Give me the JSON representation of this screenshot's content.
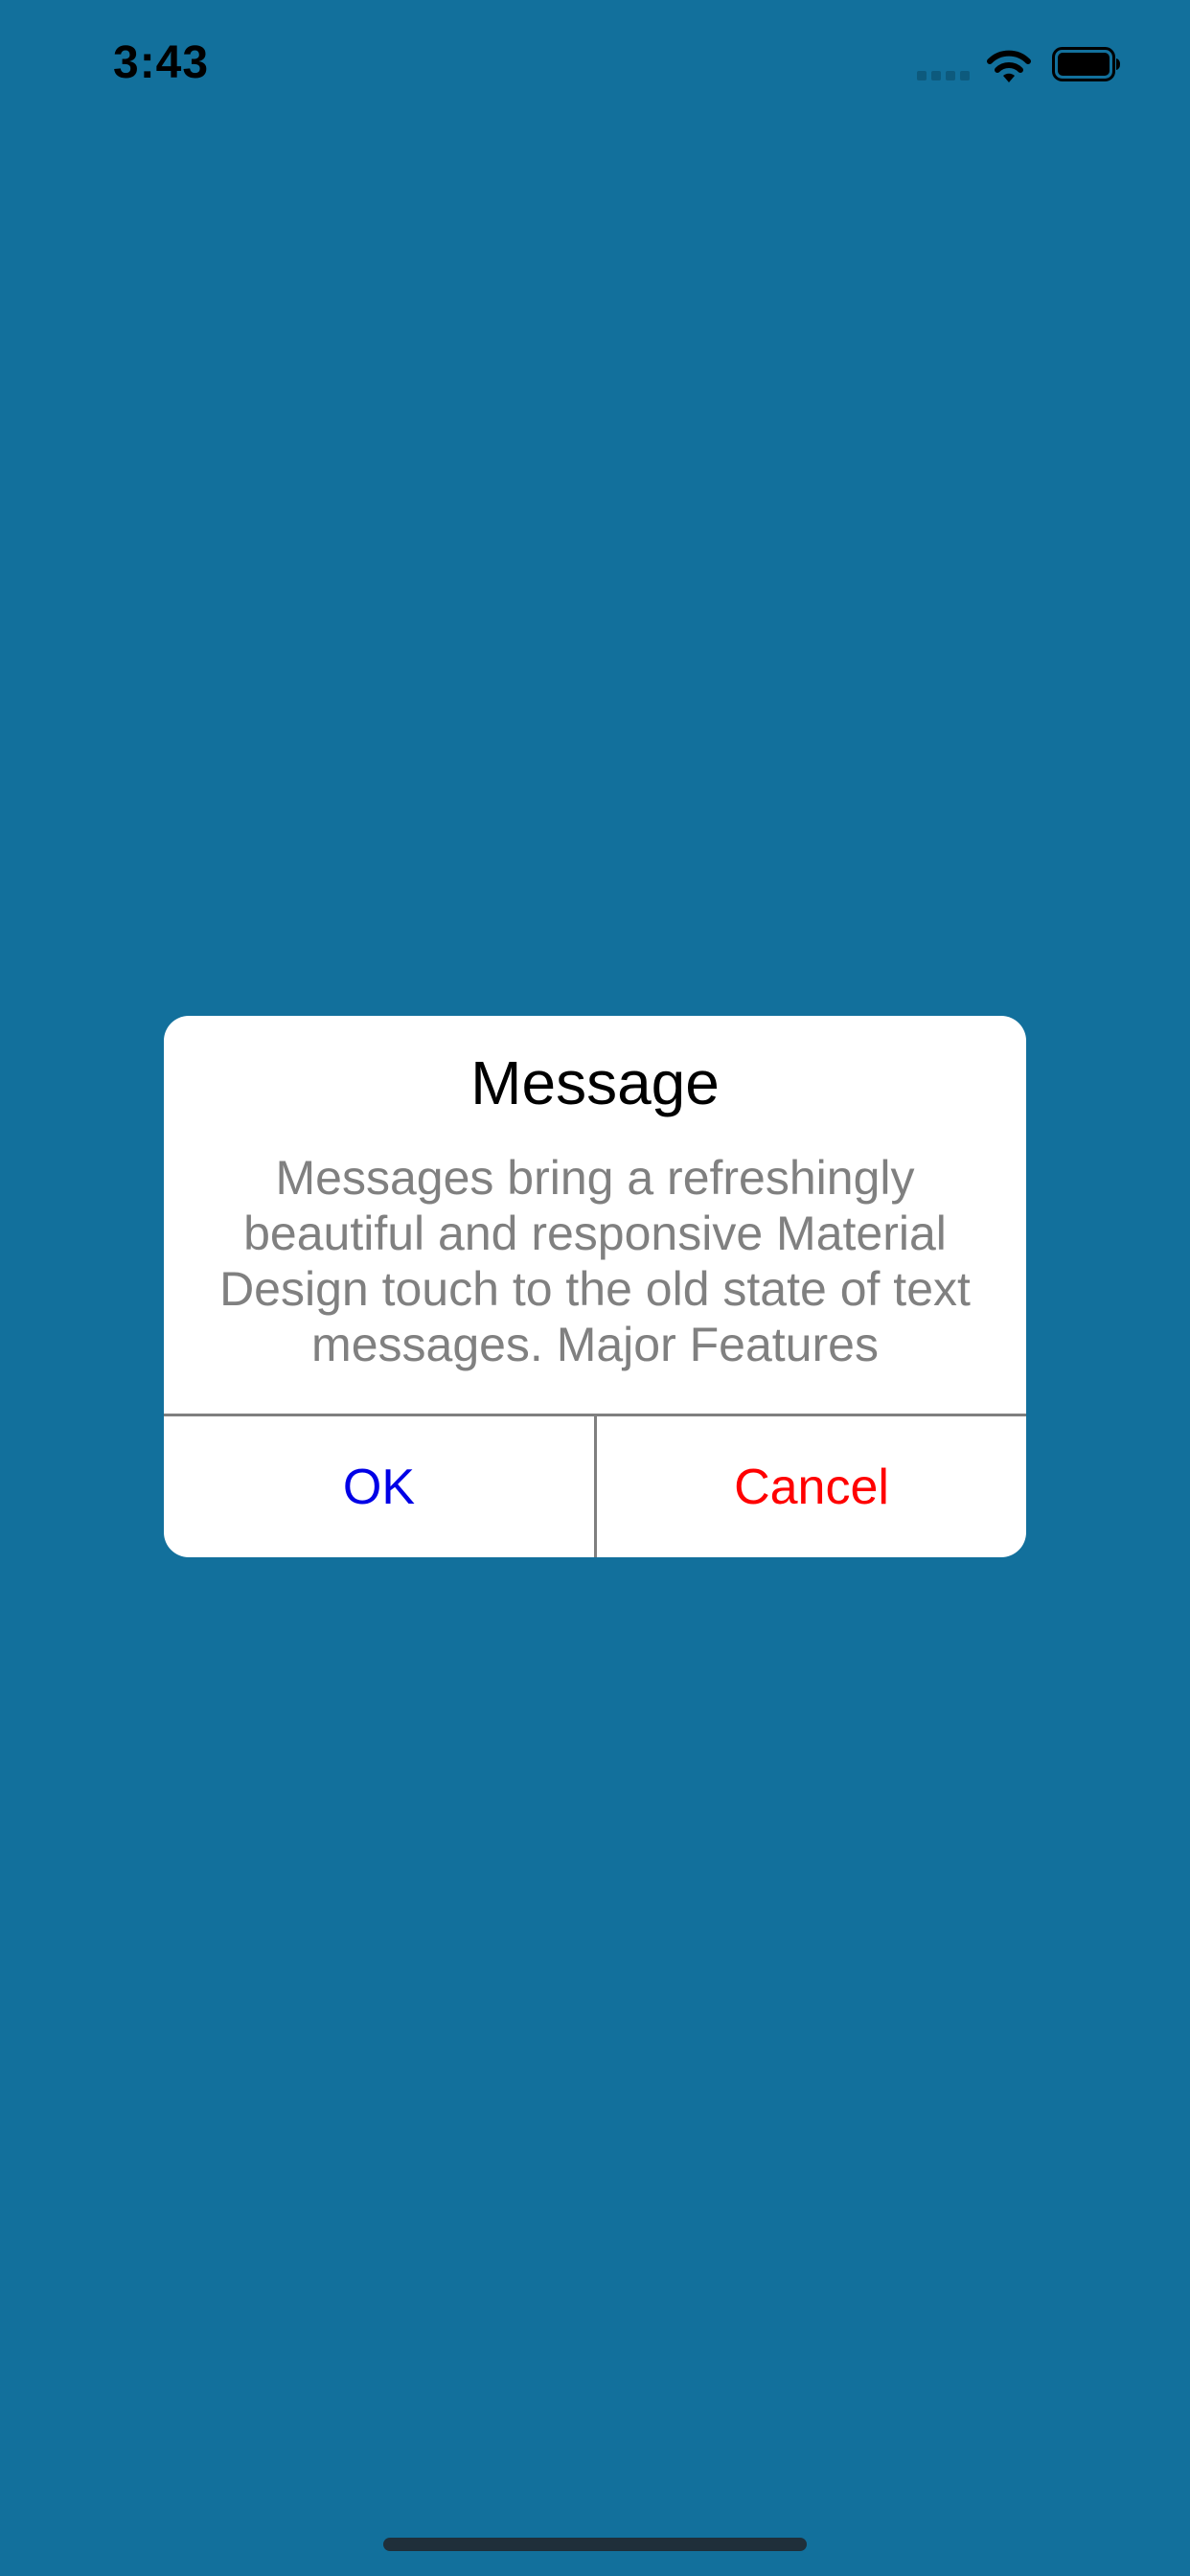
{
  "status_bar": {
    "time": "3:43",
    "icons": [
      "cellular-signal-icon",
      "wifi-icon",
      "battery-icon"
    ]
  },
  "colors": {
    "background": "#12709c",
    "ok_button": "#0000e6",
    "cancel_button": "#ff0000",
    "message_text": "#808080"
  },
  "dialog": {
    "title": "Message",
    "message": "Messages bring a refreshingly beautiful and responsive Material Design touch to the old state of text messages. Major Features",
    "ok_label": "OK",
    "cancel_label": "Cancel"
  }
}
